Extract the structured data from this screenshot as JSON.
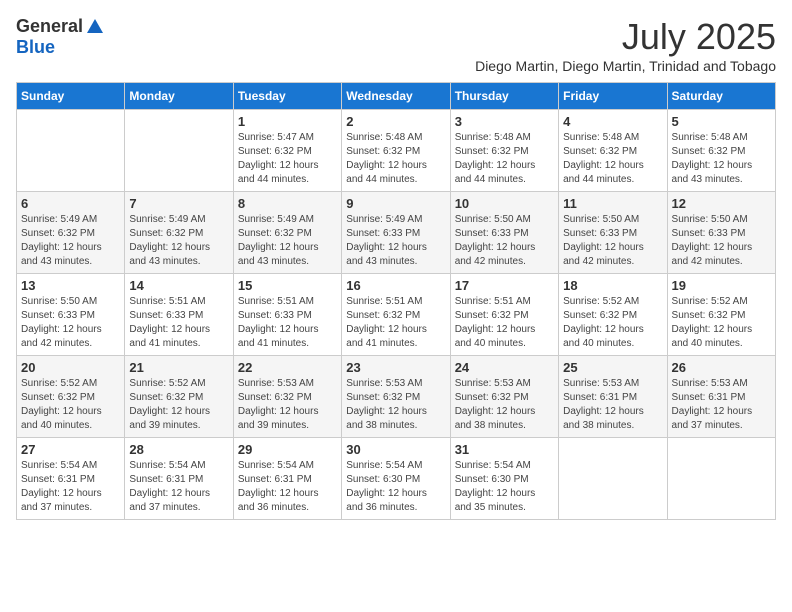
{
  "logo": {
    "general": "General",
    "blue": "Blue"
  },
  "title": "July 2025",
  "subtitle": "Diego Martin, Diego Martin, Trinidad and Tobago",
  "days_of_week": [
    "Sunday",
    "Monday",
    "Tuesday",
    "Wednesday",
    "Thursday",
    "Friday",
    "Saturday"
  ],
  "weeks": [
    [
      {
        "day": "",
        "info": ""
      },
      {
        "day": "",
        "info": ""
      },
      {
        "day": "1",
        "info": "Sunrise: 5:47 AM\nSunset: 6:32 PM\nDaylight: 12 hours and 44 minutes."
      },
      {
        "day": "2",
        "info": "Sunrise: 5:48 AM\nSunset: 6:32 PM\nDaylight: 12 hours and 44 minutes."
      },
      {
        "day": "3",
        "info": "Sunrise: 5:48 AM\nSunset: 6:32 PM\nDaylight: 12 hours and 44 minutes."
      },
      {
        "day": "4",
        "info": "Sunrise: 5:48 AM\nSunset: 6:32 PM\nDaylight: 12 hours and 44 minutes."
      },
      {
        "day": "5",
        "info": "Sunrise: 5:48 AM\nSunset: 6:32 PM\nDaylight: 12 hours and 43 minutes."
      }
    ],
    [
      {
        "day": "6",
        "info": "Sunrise: 5:49 AM\nSunset: 6:32 PM\nDaylight: 12 hours and 43 minutes."
      },
      {
        "day": "7",
        "info": "Sunrise: 5:49 AM\nSunset: 6:32 PM\nDaylight: 12 hours and 43 minutes."
      },
      {
        "day": "8",
        "info": "Sunrise: 5:49 AM\nSunset: 6:32 PM\nDaylight: 12 hours and 43 minutes."
      },
      {
        "day": "9",
        "info": "Sunrise: 5:49 AM\nSunset: 6:33 PM\nDaylight: 12 hours and 43 minutes."
      },
      {
        "day": "10",
        "info": "Sunrise: 5:50 AM\nSunset: 6:33 PM\nDaylight: 12 hours and 42 minutes."
      },
      {
        "day": "11",
        "info": "Sunrise: 5:50 AM\nSunset: 6:33 PM\nDaylight: 12 hours and 42 minutes."
      },
      {
        "day": "12",
        "info": "Sunrise: 5:50 AM\nSunset: 6:33 PM\nDaylight: 12 hours and 42 minutes."
      }
    ],
    [
      {
        "day": "13",
        "info": "Sunrise: 5:50 AM\nSunset: 6:33 PM\nDaylight: 12 hours and 42 minutes."
      },
      {
        "day": "14",
        "info": "Sunrise: 5:51 AM\nSunset: 6:33 PM\nDaylight: 12 hours and 41 minutes."
      },
      {
        "day": "15",
        "info": "Sunrise: 5:51 AM\nSunset: 6:33 PM\nDaylight: 12 hours and 41 minutes."
      },
      {
        "day": "16",
        "info": "Sunrise: 5:51 AM\nSunset: 6:32 PM\nDaylight: 12 hours and 41 minutes."
      },
      {
        "day": "17",
        "info": "Sunrise: 5:51 AM\nSunset: 6:32 PM\nDaylight: 12 hours and 40 minutes."
      },
      {
        "day": "18",
        "info": "Sunrise: 5:52 AM\nSunset: 6:32 PM\nDaylight: 12 hours and 40 minutes."
      },
      {
        "day": "19",
        "info": "Sunrise: 5:52 AM\nSunset: 6:32 PM\nDaylight: 12 hours and 40 minutes."
      }
    ],
    [
      {
        "day": "20",
        "info": "Sunrise: 5:52 AM\nSunset: 6:32 PM\nDaylight: 12 hours and 40 minutes."
      },
      {
        "day": "21",
        "info": "Sunrise: 5:52 AM\nSunset: 6:32 PM\nDaylight: 12 hours and 39 minutes."
      },
      {
        "day": "22",
        "info": "Sunrise: 5:53 AM\nSunset: 6:32 PM\nDaylight: 12 hours and 39 minutes."
      },
      {
        "day": "23",
        "info": "Sunrise: 5:53 AM\nSunset: 6:32 PM\nDaylight: 12 hours and 38 minutes."
      },
      {
        "day": "24",
        "info": "Sunrise: 5:53 AM\nSunset: 6:32 PM\nDaylight: 12 hours and 38 minutes."
      },
      {
        "day": "25",
        "info": "Sunrise: 5:53 AM\nSunset: 6:31 PM\nDaylight: 12 hours and 38 minutes."
      },
      {
        "day": "26",
        "info": "Sunrise: 5:53 AM\nSunset: 6:31 PM\nDaylight: 12 hours and 37 minutes."
      }
    ],
    [
      {
        "day": "27",
        "info": "Sunrise: 5:54 AM\nSunset: 6:31 PM\nDaylight: 12 hours and 37 minutes."
      },
      {
        "day": "28",
        "info": "Sunrise: 5:54 AM\nSunset: 6:31 PM\nDaylight: 12 hours and 37 minutes."
      },
      {
        "day": "29",
        "info": "Sunrise: 5:54 AM\nSunset: 6:31 PM\nDaylight: 12 hours and 36 minutes."
      },
      {
        "day": "30",
        "info": "Sunrise: 5:54 AM\nSunset: 6:30 PM\nDaylight: 12 hours and 36 minutes."
      },
      {
        "day": "31",
        "info": "Sunrise: 5:54 AM\nSunset: 6:30 PM\nDaylight: 12 hours and 35 minutes."
      },
      {
        "day": "",
        "info": ""
      },
      {
        "day": "",
        "info": ""
      }
    ]
  ]
}
